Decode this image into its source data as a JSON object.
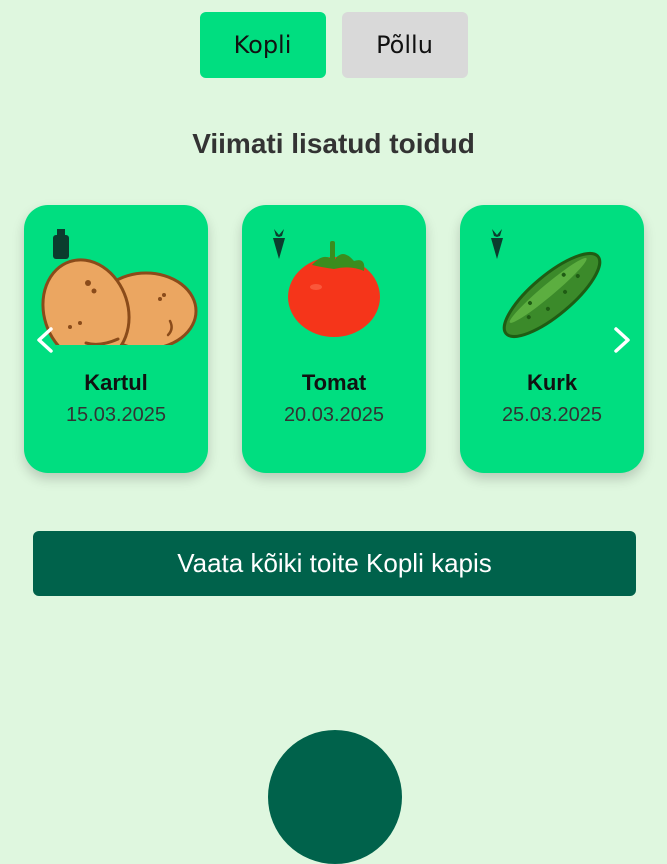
{
  "tabs": [
    {
      "label": "Kopli",
      "active": true
    },
    {
      "label": "Põllu",
      "active": false
    }
  ],
  "heading": "Viimati lisatud toidud",
  "cards": [
    {
      "name": "Kartul",
      "date": "15.03.2025",
      "image_icon": "potato-icon",
      "badge_icon": "bottle-icon"
    },
    {
      "name": "Tomat",
      "date": "20.03.2025",
      "image_icon": "tomato-icon",
      "badge_icon": "carrot-icon"
    },
    {
      "name": "Kurk",
      "date": "25.03.2025",
      "image_icon": "cucumber-icon",
      "badge_icon": "carrot-icon"
    }
  ],
  "view_all_button": "Vaata kõiki toite Kopli kapis",
  "colors": {
    "background": "#dff7df",
    "accent": "#00de80",
    "dark_green": "#00624b",
    "inactive_tab": "#d9d9d9"
  }
}
